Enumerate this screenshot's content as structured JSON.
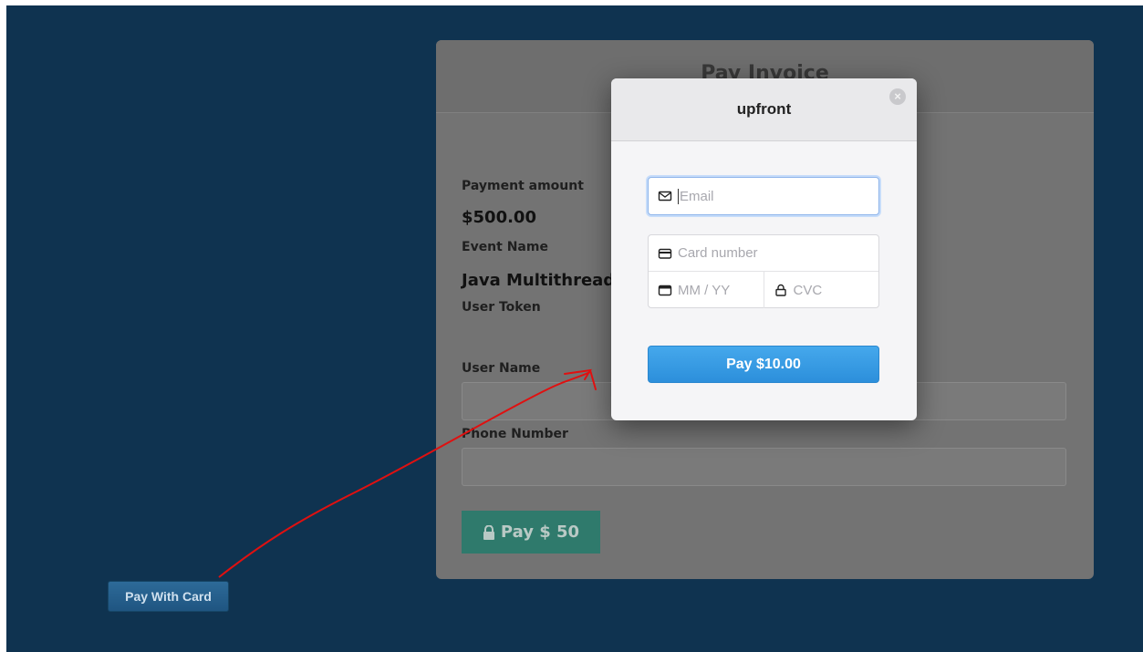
{
  "invoice": {
    "title": "Pay Invoice",
    "payment_amount_label": "Payment amount",
    "payment_amount_value": "$500.00",
    "event_name_label": "Event Name",
    "event_name_value": "Java Multithreading",
    "user_token_label": "User Token",
    "user_name_label": "User Name",
    "phone_number_label": "Phone Number",
    "pay_button_label": "Pay $ 50"
  },
  "modal": {
    "title": "upfront",
    "close_glyph": "×",
    "email_placeholder": "Email",
    "card_number_placeholder": "Card number",
    "expiry_placeholder": "MM / YY",
    "cvc_placeholder": "CVC",
    "pay_button_label": "Pay $10.00"
  },
  "pay_with_card_label": "Pay With Card",
  "colors": {
    "background": "#0f3350",
    "stripe_blue": "#3399e6",
    "annotation_red": "#e01010",
    "pay_green": "#2f7a6c"
  },
  "icons": [
    "envelope-icon",
    "credit-card-icon",
    "calendar-icon",
    "lock-icon",
    "close-icon"
  ]
}
